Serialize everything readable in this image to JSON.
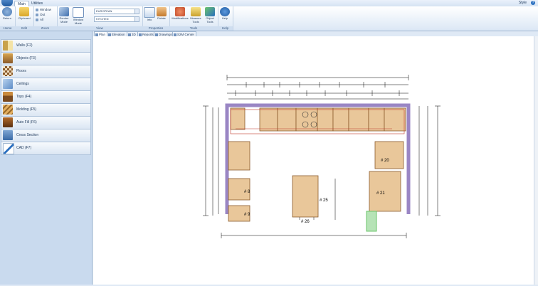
{
  "ribbon_tabs": [
    "Main",
    "Utilities"
  ],
  "style_label": "Style",
  "help_glyph": "?",
  "groups": {
    "home": {
      "label": "Home",
      "return_label": "Return"
    },
    "edit": {
      "label": "Edit",
      "clipboard_label": "Clipboard"
    },
    "zoom": {
      "label": "Zoom",
      "window_label": "Window",
      "out_label": "Out",
      "all_label": "All"
    },
    "view": {
      "label": "View",
      "render_mode_label": "Render Mode",
      "window_mode_label": "Window Mode",
      "style_value": "EUROPEAN",
      "room_value": "KITCHEN"
    },
    "properties": {
      "label": "Properties",
      "info_label": "Info",
      "rotate_label": "Rotate"
    },
    "tools": {
      "label": "Tools",
      "modifications_label": "Modifications",
      "measure_label": "Measure Tools",
      "object_label": "Object Tools"
    },
    "help": {
      "label": "Help",
      "help_label": "Help"
    }
  },
  "doc_tabs": [
    "Plan",
    "Elevation",
    "3D",
    "Reports",
    "Drawings",
    "S2M Center"
  ],
  "sidebar": [
    {
      "label": "Walls (F2)",
      "icon": "walls-icon"
    },
    {
      "label": "Objects (F3)",
      "icon": "objects-icon"
    },
    {
      "label": "Floors",
      "icon": "floors-icon"
    },
    {
      "label": "Ceilings",
      "icon": "ceilings-icon"
    },
    {
      "label": "Tops (F4)",
      "icon": "tops-icon"
    },
    {
      "label": "Molding (F5)",
      "icon": "molding-icon"
    },
    {
      "label": "Auto Fill (F6)",
      "icon": "auto-fill-icon"
    },
    {
      "label": "Cross Section",
      "icon": "cross-section-icon"
    },
    {
      "label": "CAD (F7)",
      "icon": "cad-icon"
    }
  ],
  "plan": {
    "labels": [
      "# 20",
      "# 21",
      "# 25",
      "# 26",
      "# 8",
      "# 9"
    ]
  },
  "colors": {
    "wall": "#9a86c4",
    "cabinet": "#8a5a2b",
    "cabinet_fill": "#e9c79a",
    "accent": "#2a6fc0",
    "dimension": "#000000",
    "selection": "#6bc46b"
  }
}
